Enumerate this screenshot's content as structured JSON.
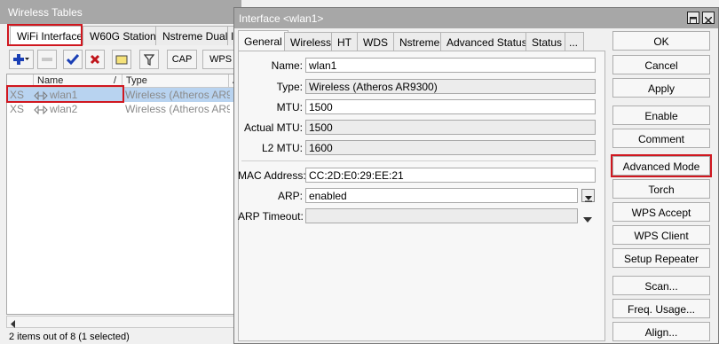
{
  "wireless_tables": {
    "title": "Wireless Tables",
    "tabs": [
      "WiFi Interfaces",
      "W60G Station",
      "Nstreme Dual",
      "I"
    ],
    "toolbar": {
      "cap_label": "CAP",
      "wps_label": "WPS"
    },
    "columns": [
      "Name",
      "/",
      "Type",
      "A"
    ],
    "rows": [
      {
        "flags": "XS",
        "name": "wlan1",
        "type": "Wireless (Atheros AR9...",
        "selected": true
      },
      {
        "flags": "XS",
        "name": "wlan2",
        "type": "Wireless (Atheros AR9...",
        "selected": false
      }
    ],
    "status": "2 items out of 8 (1 selected)"
  },
  "interface_window": {
    "title": "Interface <wlan1>",
    "tabs": [
      "General",
      "Wireless",
      "HT",
      "WDS",
      "Nstreme",
      "Advanced Status",
      "Status",
      "..."
    ],
    "fields": {
      "name": {
        "label": "Name:",
        "value": "wlan1"
      },
      "type": {
        "label": "Type:",
        "value": "Wireless (Atheros AR9300)"
      },
      "mtu": {
        "label": "MTU:",
        "value": "1500"
      },
      "actual_mtu": {
        "label": "Actual MTU:",
        "value": "1500"
      },
      "l2_mtu": {
        "label": "L2 MTU:",
        "value": "1600"
      },
      "mac": {
        "label": "MAC Address:",
        "value": "CC:2D:E0:29:EE:21"
      },
      "arp": {
        "label": "ARP:",
        "value": "enabled"
      },
      "arp_timeout": {
        "label": "ARP Timeout:",
        "value": ""
      }
    },
    "buttons": [
      "OK",
      "Cancel",
      "Apply",
      "Enable",
      "Comment",
      "Advanced Mode",
      "Torch",
      "WPS Accept",
      "WPS Client",
      "Setup Repeater",
      "Scan...",
      "Freq. Usage...",
      "Align..."
    ]
  },
  "colors": {
    "highlight": "#d0171f",
    "selection": "#b8d3f0",
    "title_bar": "#a7a7a7",
    "add_icon": "#1a3fb5",
    "remove_icon": "#c0161c"
  }
}
